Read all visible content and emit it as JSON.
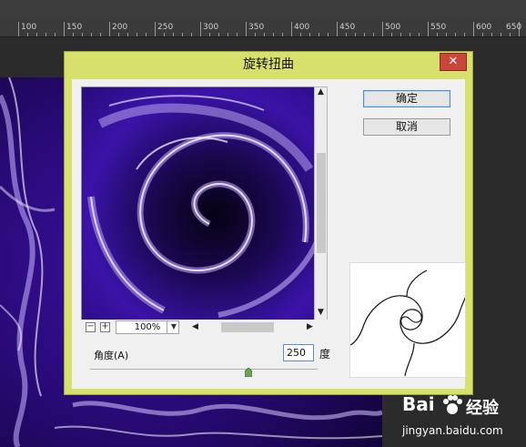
{
  "ruler": {
    "labels": [
      "100",
      "150",
      "200",
      "250",
      "300",
      "350",
      "400",
      "450",
      "500",
      "550",
      "600",
      "650"
    ]
  },
  "dialog": {
    "title": "旋转扭曲",
    "close_glyph": "✕",
    "ok_label": "确定",
    "cancel_label": "取消",
    "zoom_minus": "−",
    "zoom_plus": "+",
    "zoom_value": "100%",
    "angle_label": "角度(A)",
    "angle_value": "250",
    "angle_unit": "度",
    "angle_slider_fraction": 0.695
  },
  "watermark": {
    "brand": "Bai",
    "brand2": "经验",
    "url": "jingyan.baidu.com"
  },
  "icons": [
    "close-icon",
    "scroll-up-icon",
    "scroll-down-icon",
    "scroll-left-icon",
    "scroll-right-icon",
    "zoom-out-icon",
    "zoom-in-icon",
    "dropdown-arrow-icon",
    "slider-knob-icon",
    "paw-icon"
  ],
  "colors": {
    "titlebar": "#d6e06a",
    "close": "#c8463c",
    "accent_purple": "#5a2bbd"
  }
}
